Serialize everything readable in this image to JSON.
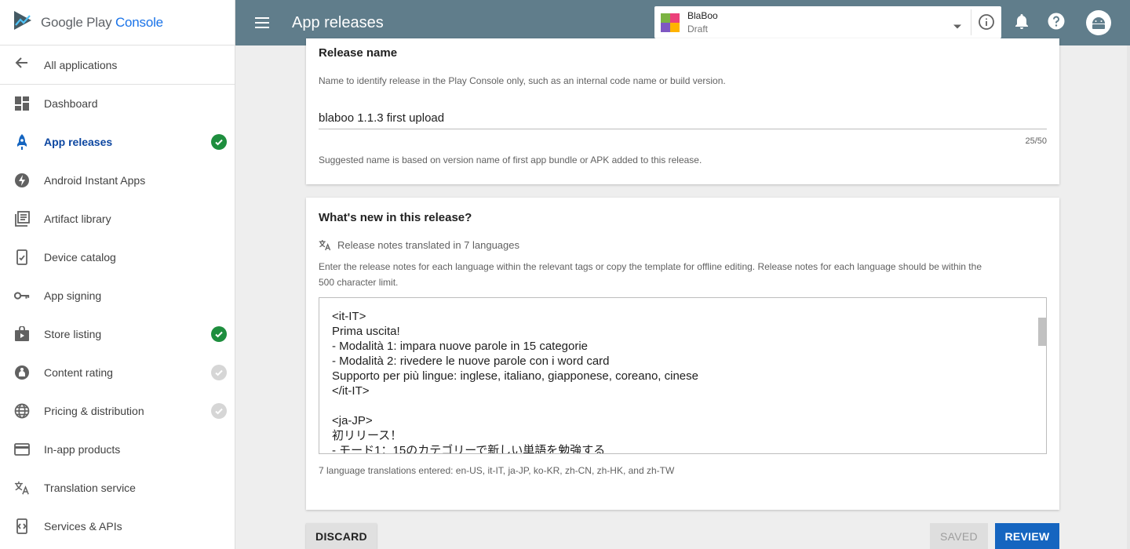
{
  "brand": {
    "name_prefix": "Google Play",
    "name_suffix": "Console"
  },
  "sidebar": {
    "back_label": "All applications",
    "items": [
      {
        "label": "Dashboard",
        "icon": "dashboard-icon",
        "status": ""
      },
      {
        "label": "App releases",
        "icon": "rocket-icon",
        "status": "complete",
        "active": true
      },
      {
        "label": "Android Instant Apps",
        "icon": "bolt-icon",
        "status": ""
      },
      {
        "label": "Artifact library",
        "icon": "library-icon",
        "status": ""
      },
      {
        "label": "Device catalog",
        "icon": "device-icon",
        "status": ""
      },
      {
        "label": "App signing",
        "icon": "key-icon",
        "status": ""
      },
      {
        "label": "Store listing",
        "icon": "store-icon",
        "status": "complete"
      },
      {
        "label": "Content rating",
        "icon": "rating-icon",
        "status": "pending"
      },
      {
        "label": "Pricing & distribution",
        "icon": "globe-icon",
        "status": "pending"
      },
      {
        "label": "In-app products",
        "icon": "card-icon",
        "status": ""
      },
      {
        "label": "Translation service",
        "icon": "translate-icon",
        "status": ""
      },
      {
        "label": "Services & APIs",
        "icon": "api-icon",
        "status": ""
      }
    ]
  },
  "topbar": {
    "title": "App releases",
    "app": {
      "name": "BlaBoo",
      "status": "Draft"
    }
  },
  "release_name": {
    "title": "Release name",
    "description": "Name to identify release in the Play Console only, such as an internal code name or build version.",
    "value": "blaboo 1.1.3 first upload",
    "counter": "25/50",
    "suggestion": "Suggested name is based on version name of first app bundle or APK added to this release."
  },
  "whats_new": {
    "title": "What's new in this release?",
    "translated_label": "Release notes translated in 7 languages",
    "instructions": "Enter the release notes for each language within the relevant tags or copy the template for offline editing. Release notes for each language should be within the",
    "instructions_line2": "500 character limit.",
    "notes": "<it-IT>\nPrima uscita!\n- Modalità 1: impara nuove parole in 15 categorie\n- Modalità 2: rivedere le nuove parole con i word card\nSupporto per più lingue: inglese, italiano, giapponese, coreano, cinese\n</it-IT>\n\n<ja-JP>\n初リリース！\n- モード1：15のカテゴリーで新しい単語を勉強する",
    "languages_entered": "7 language translations entered: en-US, it-IT, ja-JP, ko-KR, zh-CN, zh-HK, and zh-TW"
  },
  "actions": {
    "discard": "DISCARD",
    "saved": "SAVED",
    "review": "REVIEW"
  },
  "colors": {
    "topbar": "#607d8b",
    "accent": "#1565c0",
    "success": "#1e8e3e"
  }
}
